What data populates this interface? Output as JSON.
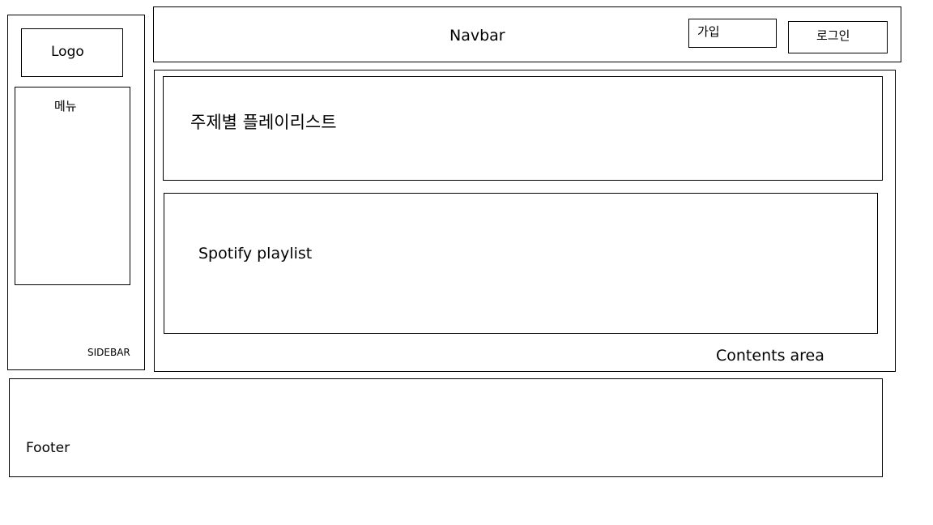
{
  "sidebar": {
    "logo": "Logo",
    "menu": "메뉴",
    "label": "SIDEBAR"
  },
  "navbar": {
    "label": "Navbar",
    "signup": "가입",
    "login": "로그인"
  },
  "contents": {
    "theme_playlist": "주제별 플레이리스트",
    "spotify_playlist": "Spotify playlist",
    "label": "Contents area"
  },
  "footer": {
    "label": "Footer"
  }
}
